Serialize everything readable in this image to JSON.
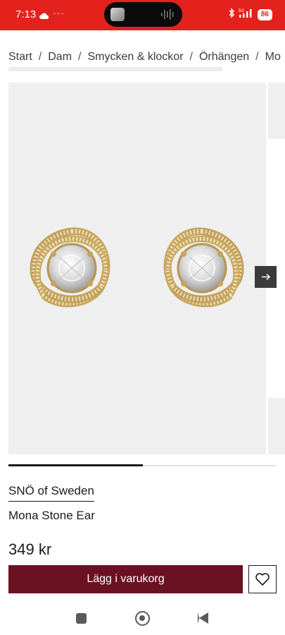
{
  "status_bar": {
    "time": "7:13",
    "dots": "···",
    "network": "5G",
    "battery": "86",
    "icons": [
      "cloud-icon",
      "bluetooth-icon",
      "signal-icon",
      "battery-icon"
    ]
  },
  "breadcrumb": {
    "items": [
      "Start",
      "Dam",
      "Smycken & klockor",
      "Örhängen",
      "Mo"
    ],
    "separator": "/"
  },
  "gallery": {
    "image_alt": "earrings-image",
    "progress": 0.5,
    "next_icon": "arrow-right-icon"
  },
  "product": {
    "brand": "SNÖ of Sweden",
    "name": "Mona Stone Ear",
    "price": "349 kr"
  },
  "actions": {
    "add_to_cart": "Lägg i varukorg",
    "wishlist_icon": "heart-icon"
  },
  "colors": {
    "status_bar": "#e3211d",
    "cart_button": "#6a1222",
    "gallery_bg": "#efefef"
  },
  "nav": {
    "icons": [
      "recents-icon",
      "home-icon",
      "back-icon"
    ]
  }
}
